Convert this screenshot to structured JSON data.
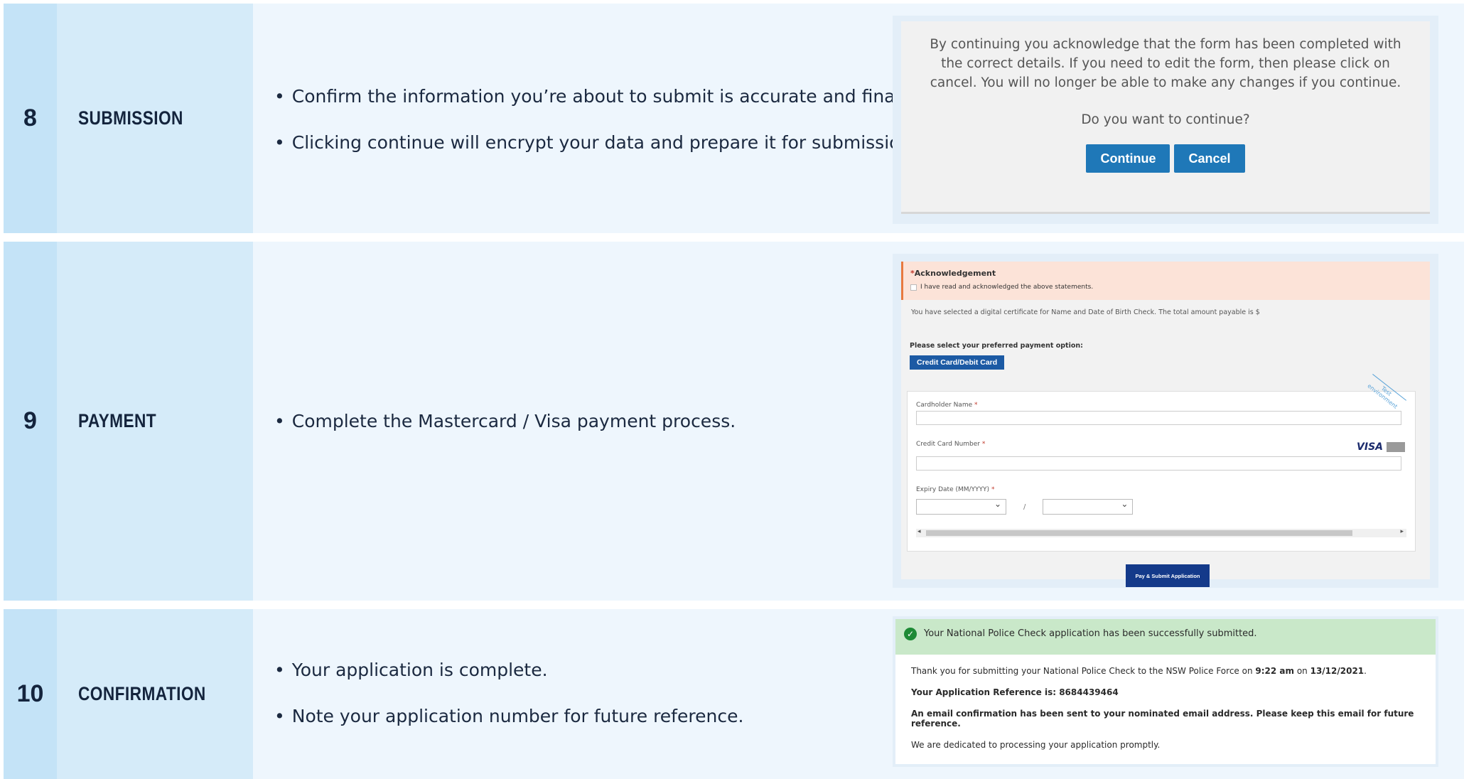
{
  "rows": [
    {
      "number": "8",
      "title": "SUBMISSION",
      "bullets": [
        "Confirm the information you’re about to submit is accurate and final.",
        "Clicking continue will encrypt your data and prepare it for submission."
      ],
      "dialog": {
        "message": "By continuing you acknowledge that the form has been completed with the correct details. If you need to edit the form, then please click on cancel. You will no longer be able to make any changes if you continue.",
        "question": "Do you want to continue?",
        "continue_label": "Continue",
        "cancel_label": "Cancel"
      }
    },
    {
      "number": "9",
      "title": "PAYMENT",
      "bullets": [
        "Complete the Mastercard / Visa payment process."
      ],
      "form": {
        "ack_heading": "Acknowledgement",
        "ack_required_mark": "*",
        "ack_checkbox_label": "I have read and acknowledged the above statements.",
        "selected_text": "You have selected a digital certificate for Name and Date of Birth Check. The total amount payable is $",
        "payment_option_label": "Please select your preferred payment option:",
        "card_button_label": "Credit Card/Debit Card",
        "cardholder_label": "Cardholder Name",
        "card_number_label": "Credit Card Number",
        "expiry_label": "Expiry Date (MM/YYYY)",
        "required_mark": "*",
        "expiry_separator": "/",
        "visa_label": "VISA",
        "ribbon_text": "Test environment",
        "pay_button_label": "Pay & Submit Application"
      }
    },
    {
      "number": "10",
      "title": "CONFIRMATION",
      "bullets": [
        "Your application is complete.",
        "Note your application number for future reference."
      ],
      "confirmation": {
        "success_message": "Your National Police Check application has been successfully submitted.",
        "thanks_prefix": "Thank you for submitting your National Police Check to the NSW Police Force on ",
        "time": "9:22 am",
        "on_word": " on ",
        "date": "13/12/2021",
        "period": ".",
        "reference_line": "Your Application Reference is: 8684439464",
        "email_line": "An email confirmation has been sent to your nominated email address. Please keep this email for future reference.",
        "dedicated_line": "We are dedicated to processing your application promptly."
      }
    }
  ]
}
